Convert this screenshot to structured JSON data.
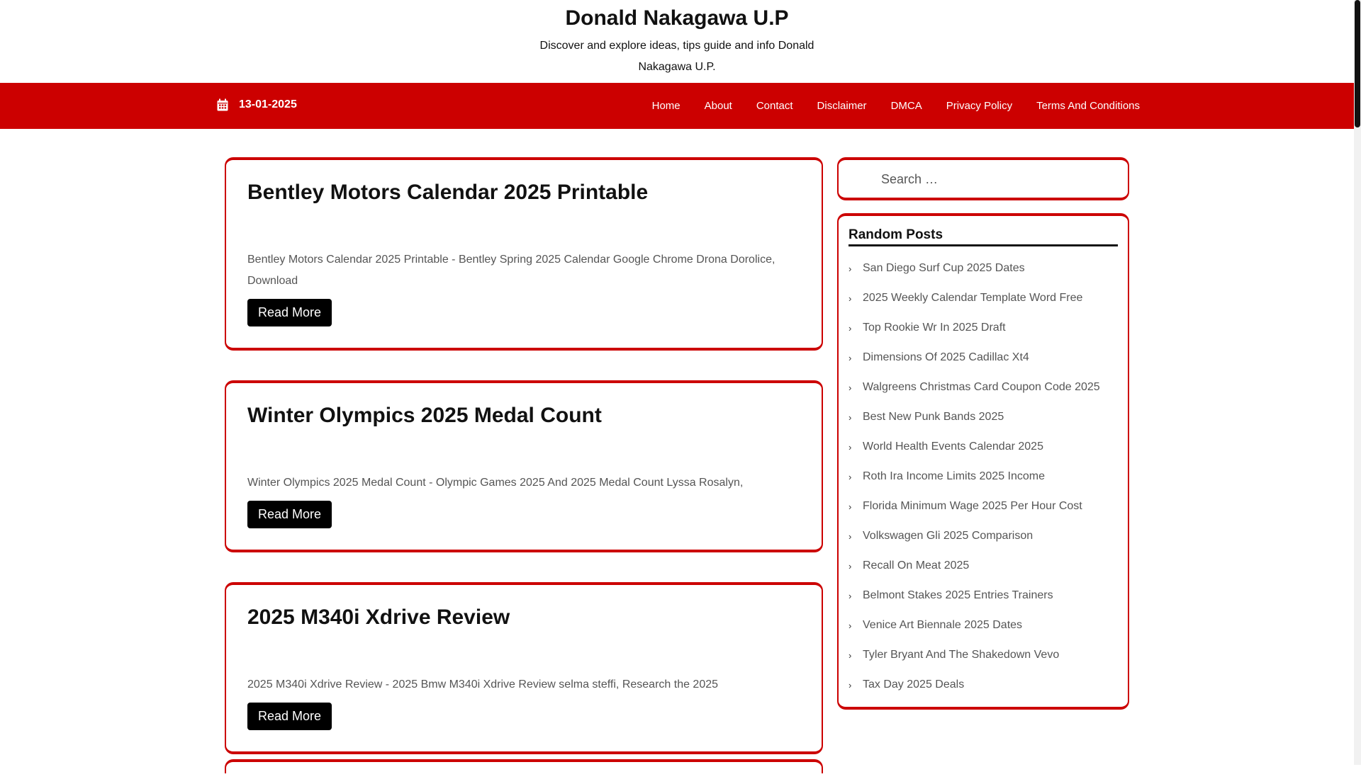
{
  "site": {
    "title": "Donald Nakagawa U.P",
    "tagline": "Discover and explore ideas, tips guide and info Donald Nakagawa U.P."
  },
  "navbar": {
    "date": "13-01-2025",
    "date_icon": "calendar-icon",
    "menu": [
      "Home",
      "About",
      "Contact",
      "Disclaimer",
      "DMCA",
      "Privacy Policy",
      "Terms And Conditions"
    ],
    "background_color": "#cc0000"
  },
  "articles": [
    {
      "title": "Bentley Motors Calendar 2025 Printable",
      "excerpt": "Bentley Motors Calendar 2025 Printable - Bentley Spring 2025 Calendar Google Chrome Drona Dorolice, Download",
      "button": "Read More"
    },
    {
      "title": "Winter Olympics 2025 Medal Count",
      "excerpt": "Winter Olympics 2025 Medal Count - Olympic Games 2025 And 2025 Medal Count Lyssa Rosalyn,",
      "button": "Read More"
    },
    {
      "title": "2025 M340i Xdrive Review",
      "excerpt": "2025 M340i Xdrive Review - 2025 Bmw M340i Xdrive Review selma steffi, Research the 2025",
      "button": "Read More"
    }
  ],
  "sidebar": {
    "search_placeholder": "Search …",
    "widget_title": "Random Posts",
    "posts": [
      "San Diego Surf Cup 2025 Dates",
      "2025 Weekly Calendar Template Word Free",
      "Top Rookie Wr In 2025 Draft",
      "Dimensions Of 2025 Cadillac Xt4",
      "Walgreens Christmas Card Coupon Code 2025",
      "Best New Punk Bands 2025",
      "World Health Events Calendar 2025",
      "Roth Ira Income Limits 2025 Income",
      "Florida Minimum Wage 2025 Per Hour Cost",
      "Volkswagen Gli 2025 Comparison",
      "Recall On Meat 2025",
      "Belmont Stakes 2025 Entries Trainers",
      "Venice Art Biennale 2025 Dates",
      "Tyler Bryant And The Shakedown Vevo",
      "Tax Day 2025 Deals"
    ]
  },
  "colors": {
    "accent": "#cc0000",
    "button": "#000000"
  }
}
